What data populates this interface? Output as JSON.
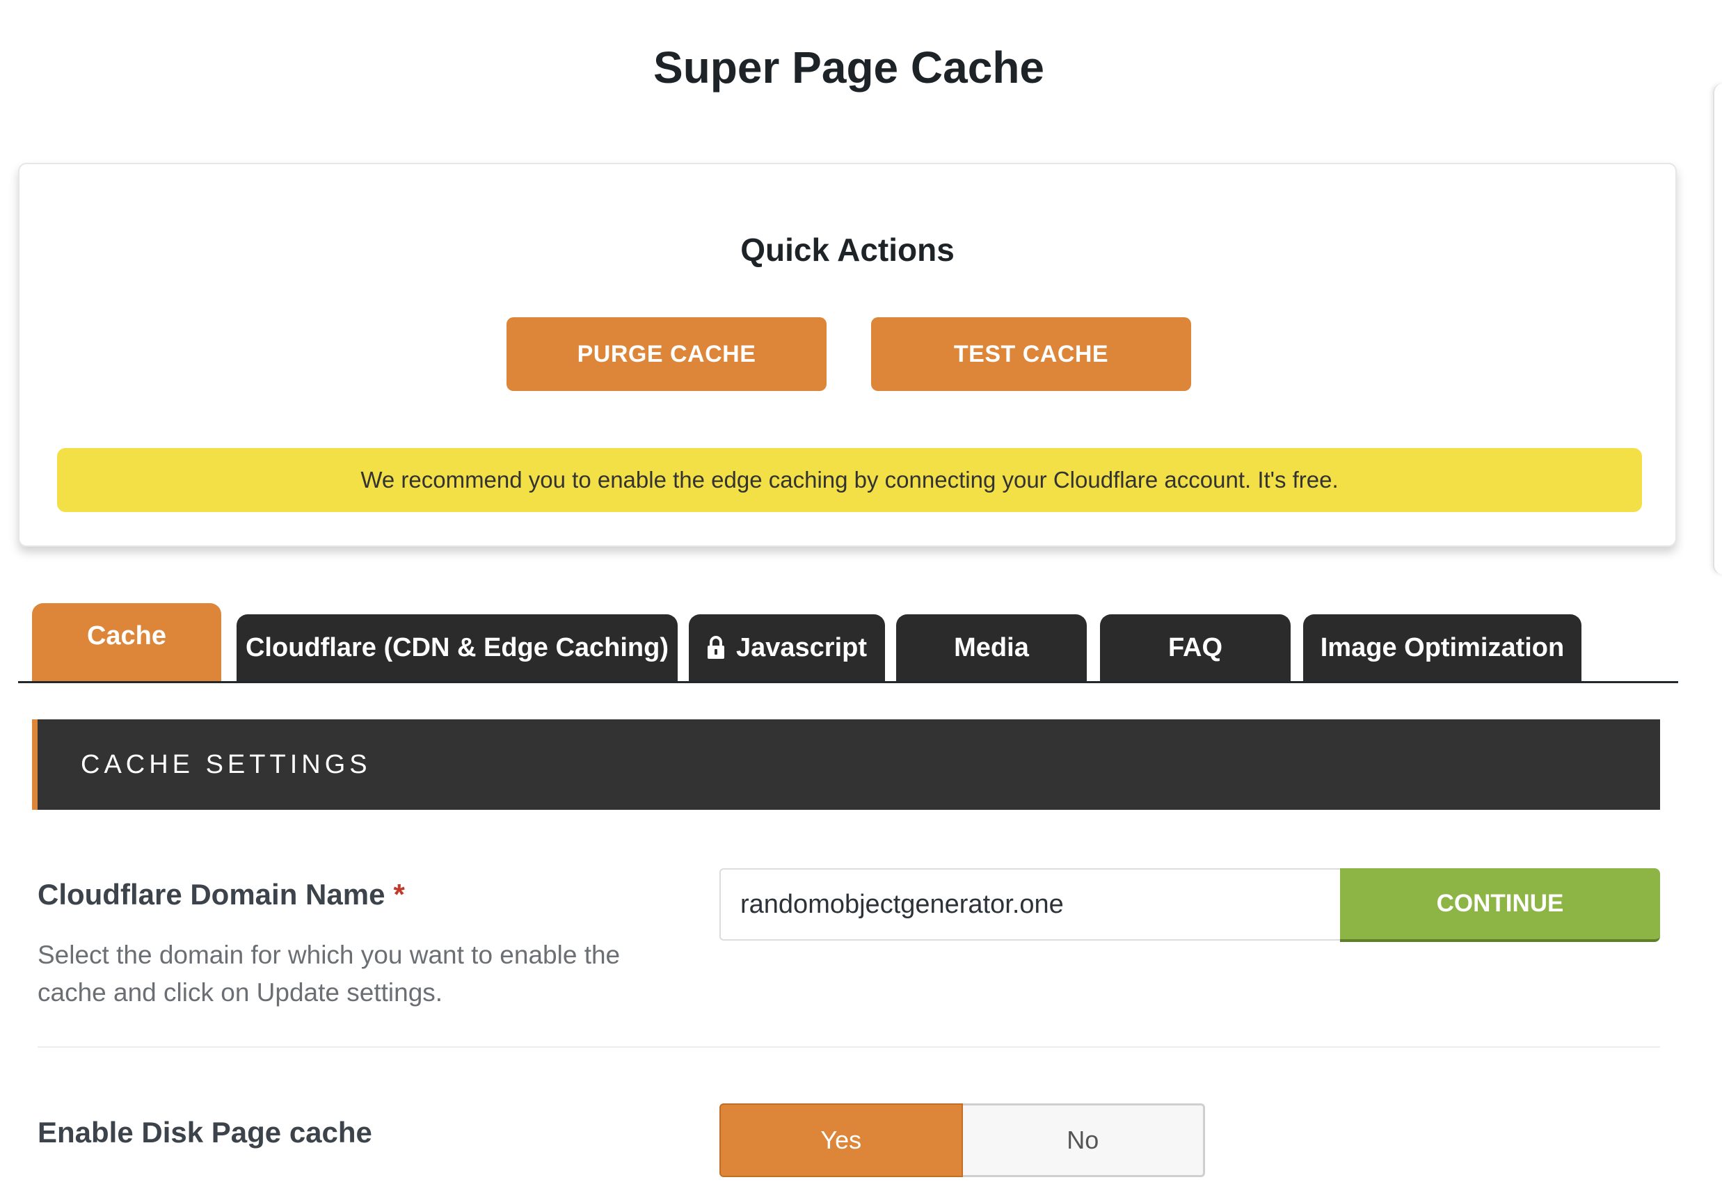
{
  "page": {
    "title": "Super Page Cache"
  },
  "quick_actions": {
    "heading": "Quick Actions",
    "purge_label": "PURGE CACHE",
    "test_label": "TEST CACHE",
    "notice": "We recommend you to enable the edge caching by connecting your Cloudflare account. It's free."
  },
  "tabs": [
    {
      "label": "Cache",
      "active": true
    },
    {
      "label": "Cloudflare (CDN & Edge Caching)",
      "active": false
    },
    {
      "label": "Javascript",
      "active": false,
      "icon": "lock-icon"
    },
    {
      "label": "Media",
      "active": false
    },
    {
      "label": "FAQ",
      "active": false
    },
    {
      "label": "Image Optimization",
      "active": false
    }
  ],
  "section": {
    "title": "CACHE SETTINGS"
  },
  "domain_setting": {
    "label": "Cloudflare Domain Name",
    "required_mark": "*",
    "description": "Select the domain for which you want to enable the cache and click on Update settings.",
    "value": "randomobjectgenerator.one",
    "button_label": "CONTINUE"
  },
  "disk_cache_setting": {
    "label": "Enable Disk Page cache",
    "options": [
      "Yes",
      "No"
    ],
    "selected": "Yes"
  },
  "colors": {
    "accent": "#dd8538",
    "notice_bg": "#f3e046",
    "tab_dark": "#2b2b2b",
    "section_bg": "#333333",
    "continue_green": "#8db545"
  }
}
